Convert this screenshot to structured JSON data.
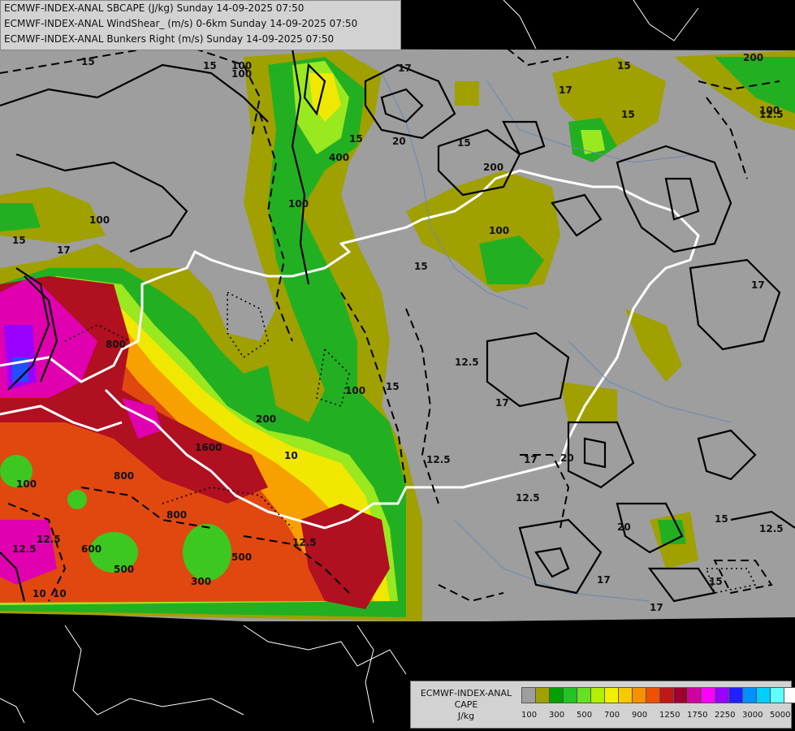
{
  "header": {
    "line1": "ECMWF-INDEX-ANAL SBCAPE (J/kg) Sunday 14-09-2025 07:50",
    "line2": "ECMWF-INDEX-ANAL WindShear_ (m/s) 0-6km Sunday 14-09-2025 07:50",
    "line3": "ECMWF-INDEX-ANAL Bunkers Right (m/s) Sunday 14-09-2025 07:50"
  },
  "legend": {
    "title1": "ECMWF-INDEX-ANAL",
    "title2": "CAPE",
    "title3": "J/kg",
    "ticks": [
      "100",
      "300",
      "500",
      "700",
      "900",
      "1250",
      "1750",
      "2250",
      "3000",
      "5000"
    ],
    "colors": [
      "#9e9e9e",
      "#a0a000",
      "#00a000",
      "#22c522",
      "#66e022",
      "#b0f000",
      "#f0f000",
      "#f8c800",
      "#f89000",
      "#f05000",
      "#c01818",
      "#a00030",
      "#d000a0",
      "#ff00ff",
      "#9900ff",
      "#2020ff",
      "#0090ff",
      "#00d0ff",
      "#60ffff",
      "#ffffff"
    ]
  },
  "map": {
    "contour_labels": [
      {
        "text": "15"
      },
      {
        "text": "100"
      },
      {
        "text": "17"
      },
      {
        "text": "15"
      },
      {
        "text": "20"
      },
      {
        "text": "15"
      },
      {
        "text": "17"
      },
      {
        "text": "15"
      },
      {
        "text": "200"
      },
      {
        "text": "12.5"
      },
      {
        "text": "100"
      },
      {
        "text": "15"
      },
      {
        "text": "400"
      },
      {
        "text": "100"
      },
      {
        "text": "100"
      },
      {
        "text": "15"
      },
      {
        "text": "17"
      },
      {
        "text": "100"
      },
      {
        "text": "200"
      },
      {
        "text": "15"
      },
      {
        "text": "100"
      },
      {
        "text": "17"
      },
      {
        "text": "15"
      },
      {
        "text": "12.5"
      },
      {
        "text": "17"
      },
      {
        "text": "800"
      },
      {
        "text": "1600"
      },
      {
        "text": "800"
      },
      {
        "text": "800"
      },
      {
        "text": "100"
      },
      {
        "text": "12.5"
      },
      {
        "text": "10"
      },
      {
        "text": "600"
      },
      {
        "text": "500"
      },
      {
        "text": "300"
      },
      {
        "text": "500"
      },
      {
        "text": "200"
      },
      {
        "text": "12.5"
      },
      {
        "text": "12.5"
      },
      {
        "text": "17"
      },
      {
        "text": "20"
      },
      {
        "text": "12.5"
      },
      {
        "text": "20"
      },
      {
        "text": "15"
      },
      {
        "text": "12.5"
      },
      {
        "text": "17"
      },
      {
        "text": "15"
      },
      {
        "text": "10"
      },
      {
        "text": "17"
      },
      {
        "text": "12.5"
      },
      {
        "text": "100"
      },
      {
        "text": "15"
      },
      {
        "text": "10"
      }
    ]
  }
}
